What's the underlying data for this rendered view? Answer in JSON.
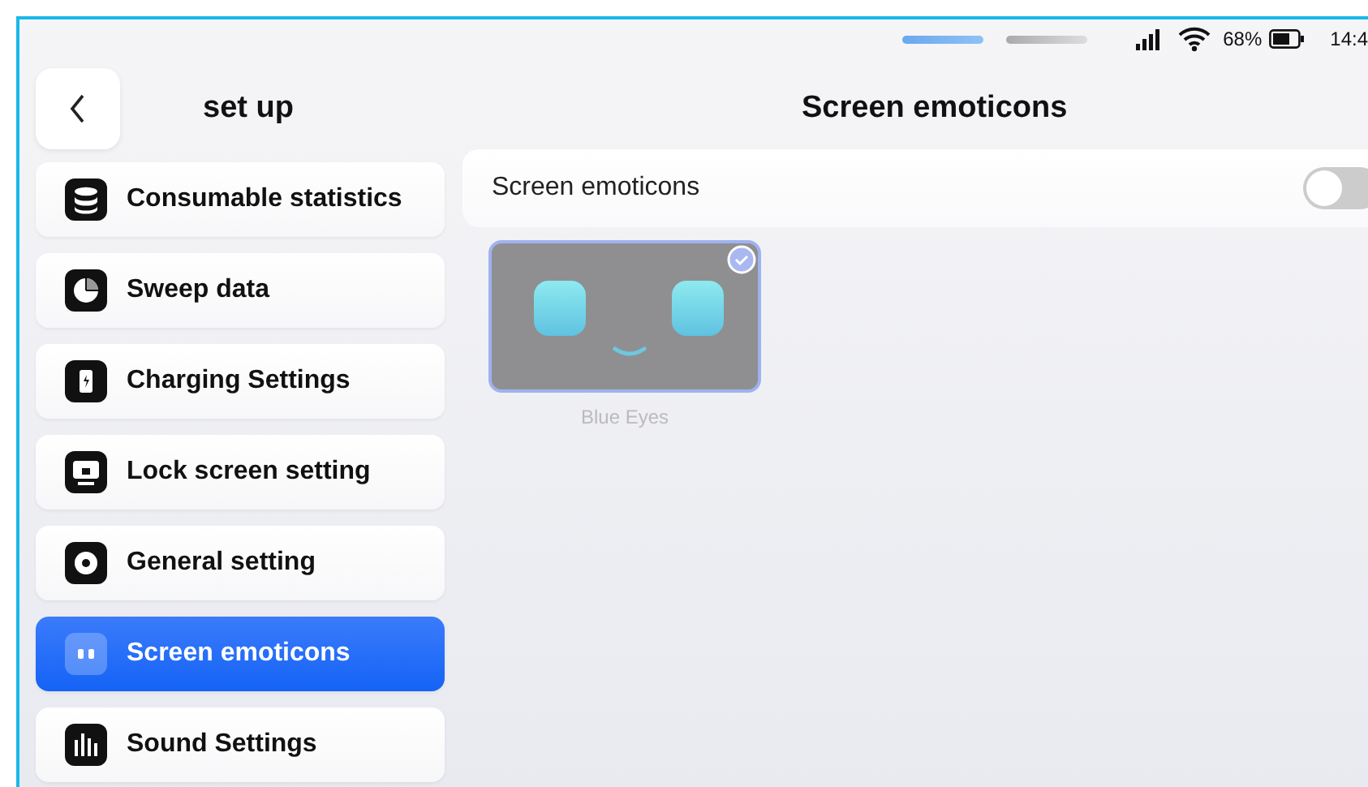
{
  "status_bar": {
    "battery_percent": "68%",
    "time": "14:4"
  },
  "sidebar": {
    "title": "set up",
    "items": [
      {
        "label": "Consumable statistics",
        "selected": false
      },
      {
        "label": "Sweep data",
        "selected": false
      },
      {
        "label": "Charging Settings",
        "selected": false
      },
      {
        "label": "Lock screen setting",
        "selected": false
      },
      {
        "label": "General setting",
        "selected": false
      },
      {
        "label": "Screen emoticons",
        "selected": true
      },
      {
        "label": "Sound Settings",
        "selected": false
      }
    ]
  },
  "content": {
    "title": "Screen emoticons",
    "toggle": {
      "label": "Screen emoticons",
      "on": false
    },
    "emoticons": [
      {
        "name": "Blue Eyes",
        "selected": true
      }
    ]
  }
}
